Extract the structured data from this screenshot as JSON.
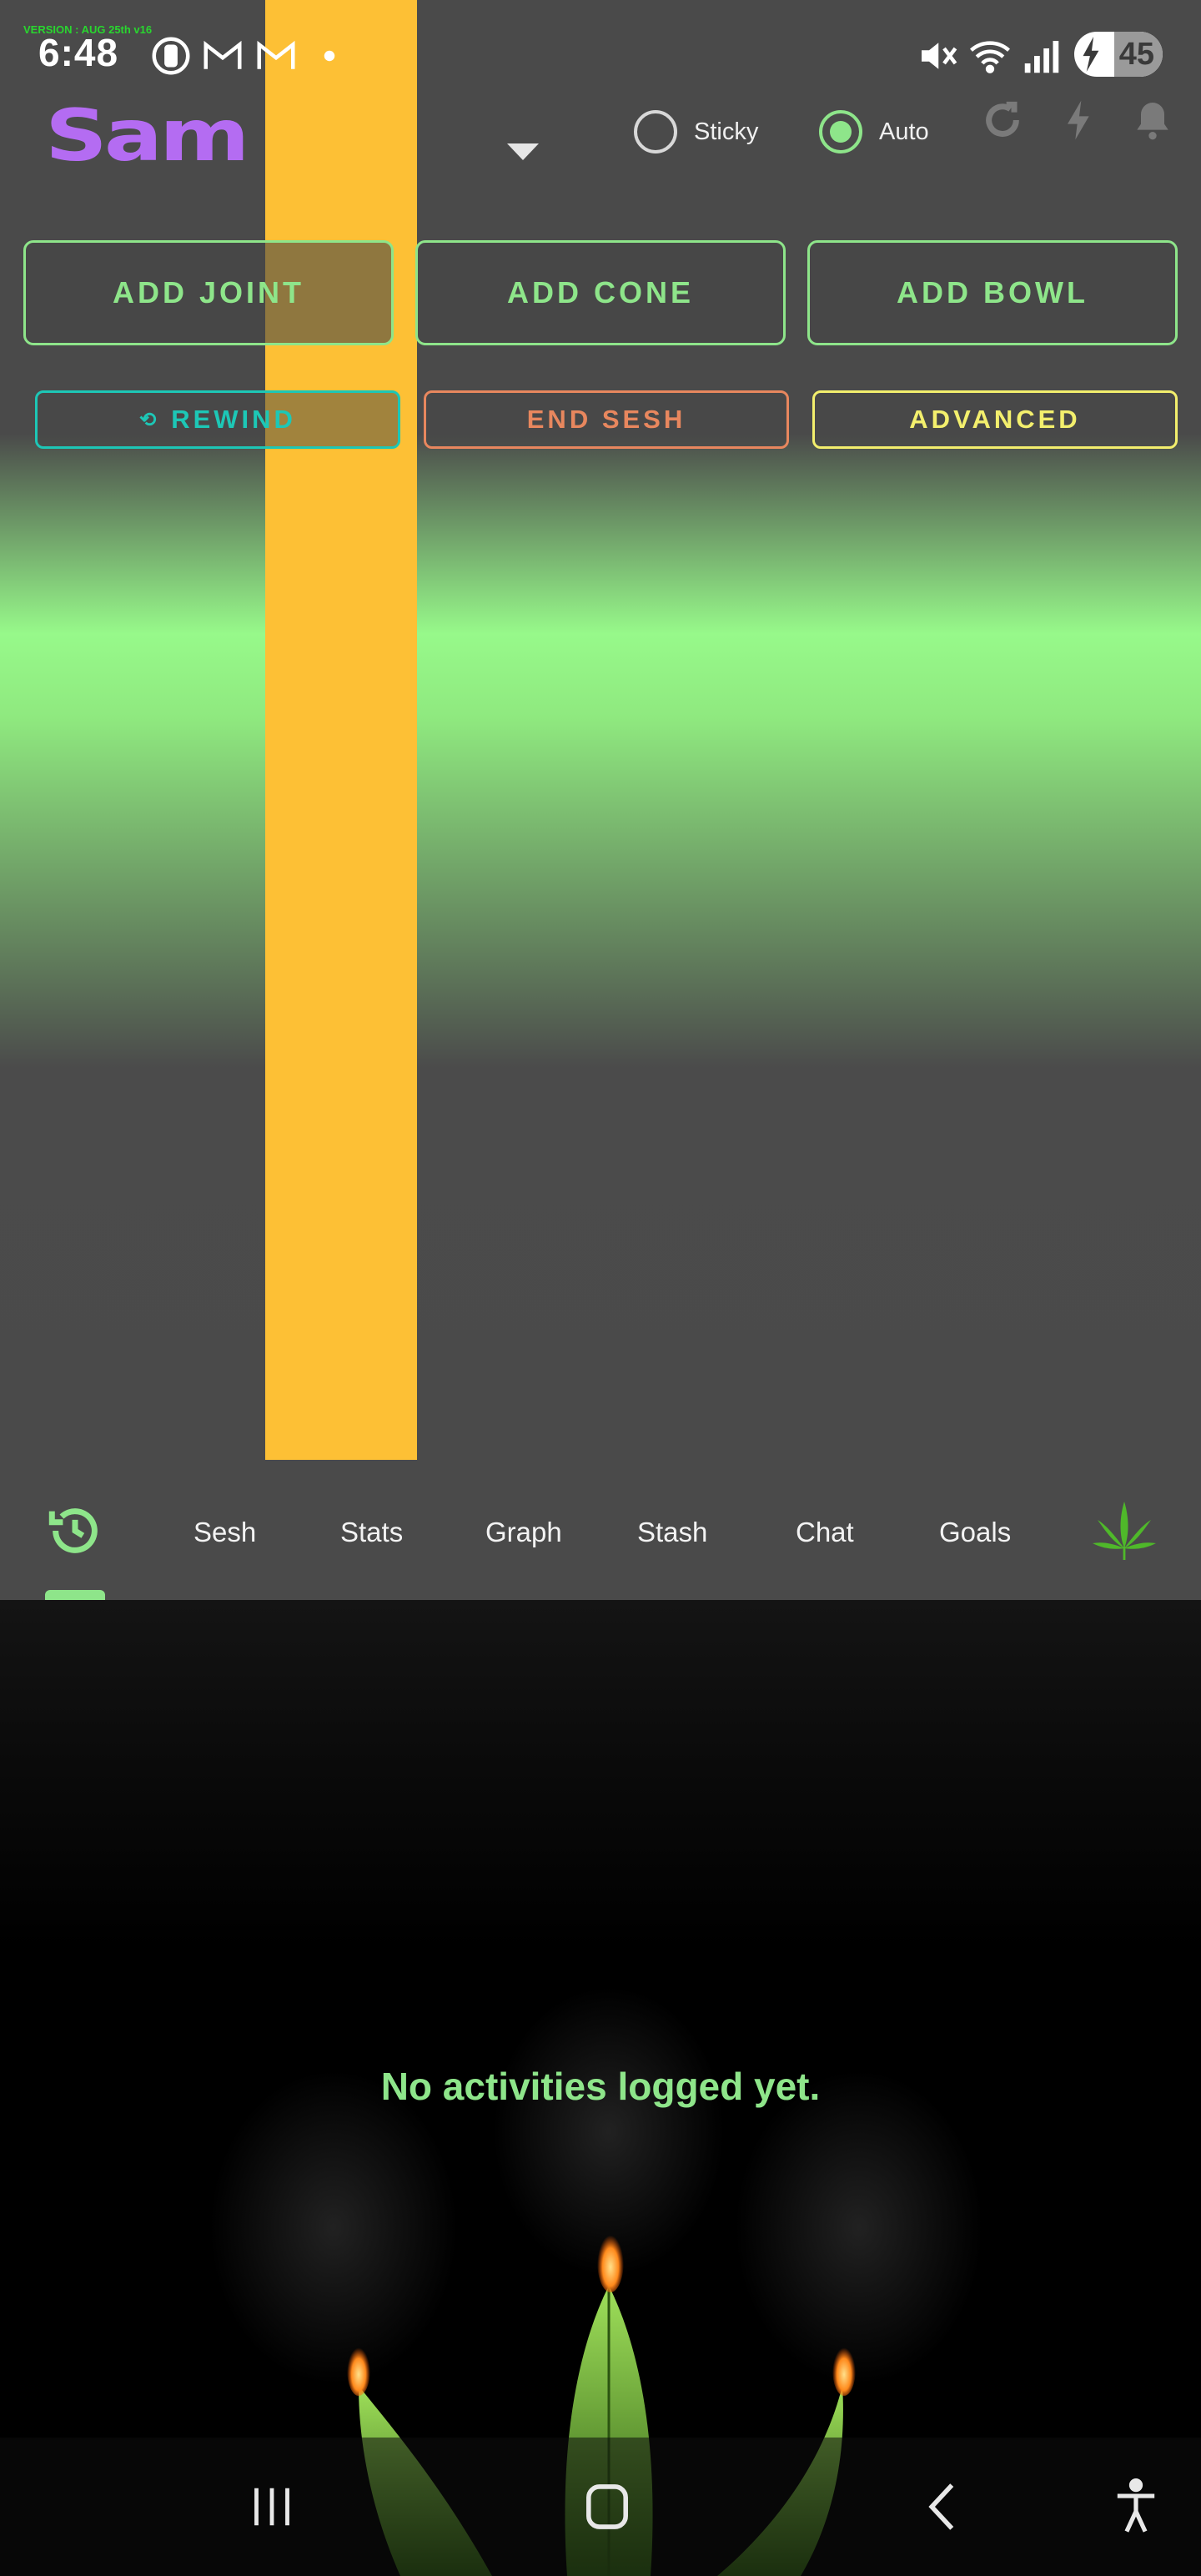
{
  "status_bar": {
    "version": "VERSION : AUG 25th v16",
    "time": "6:48",
    "battery": "45",
    "battery_level": 0.45,
    "icons": [
      "alarm-icon",
      "gmail-icon",
      "gmail-icon",
      "notification-dot-icon",
      "mute-icon",
      "wifi-icon",
      "signal-icon",
      "battery-charging-icon"
    ]
  },
  "header": {
    "user_name": "Sam",
    "radio_options": [
      {
        "label": "Sticky",
        "selected": false
      },
      {
        "label": "Auto",
        "selected": true
      }
    ],
    "icons": [
      "refresh-icon",
      "lightning-icon",
      "bell-icon"
    ]
  },
  "actions": {
    "primary": [
      "ADD JOINT",
      "ADD CONE",
      "ADD BOWL"
    ],
    "secondary": [
      {
        "label": "REWIND",
        "icon": "rewind-icon",
        "color": "#1dc7b6"
      },
      {
        "label": "END SESH",
        "color": "#e8875e"
      },
      {
        "label": "ADVANCED",
        "color": "#f3ef6d"
      }
    ]
  },
  "tabs": {
    "items": [
      "Sesh",
      "Stats",
      "Graph",
      "Stash",
      "Chat",
      "Goals"
    ],
    "first_icon": "history-icon",
    "last_icon": "cannabis-leaf-icon",
    "selected": 0
  },
  "content": {
    "empty_message": "No activities logged yet."
  },
  "colors": {
    "accent": "#8ee58a",
    "logo": "#b46cf2",
    "bar": "#fdc035"
  }
}
